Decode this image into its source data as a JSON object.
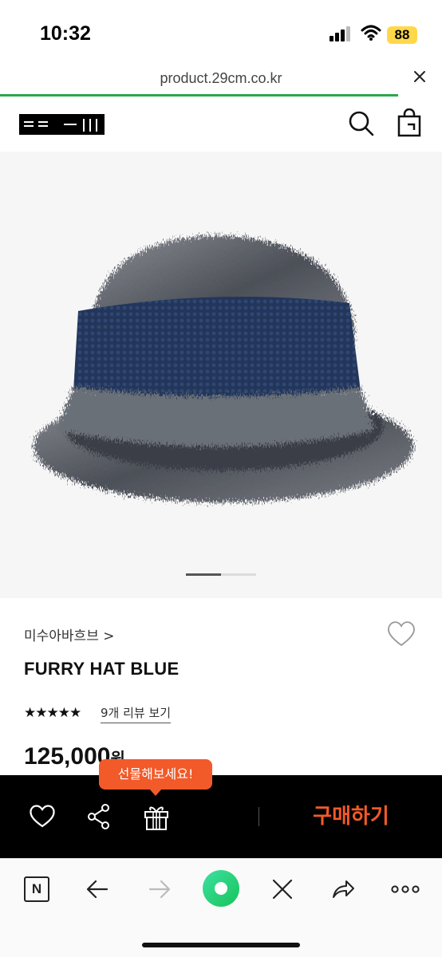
{
  "status": {
    "time": "10:32",
    "battery": "88"
  },
  "browser": {
    "url": "product.29cm.co.kr",
    "load_progress_pct": 90
  },
  "product": {
    "brand": "미수아바흐브 >",
    "name": "FURRY HAT BLUE",
    "rating_stars": "★★★★★",
    "reviews_link": "9개 리뷰 보기",
    "price": "125,000",
    "price_unit": "원",
    "image_count": 2,
    "image_index": 1
  },
  "gift_tooltip": "선물해보세요!",
  "action_bar": {
    "buy_label": "구매하기"
  },
  "colors": {
    "accent": "#f25a29",
    "progress": "#2aa84a",
    "home_green": "#1fc96a"
  },
  "icons": [
    "cellular-signal-icon",
    "wifi-icon",
    "close-icon",
    "search-icon",
    "shopping-bag-icon",
    "heart-icon",
    "share-icon",
    "gift-icon",
    "back-arrow-icon",
    "forward-arrow-icon",
    "more-icon"
  ]
}
